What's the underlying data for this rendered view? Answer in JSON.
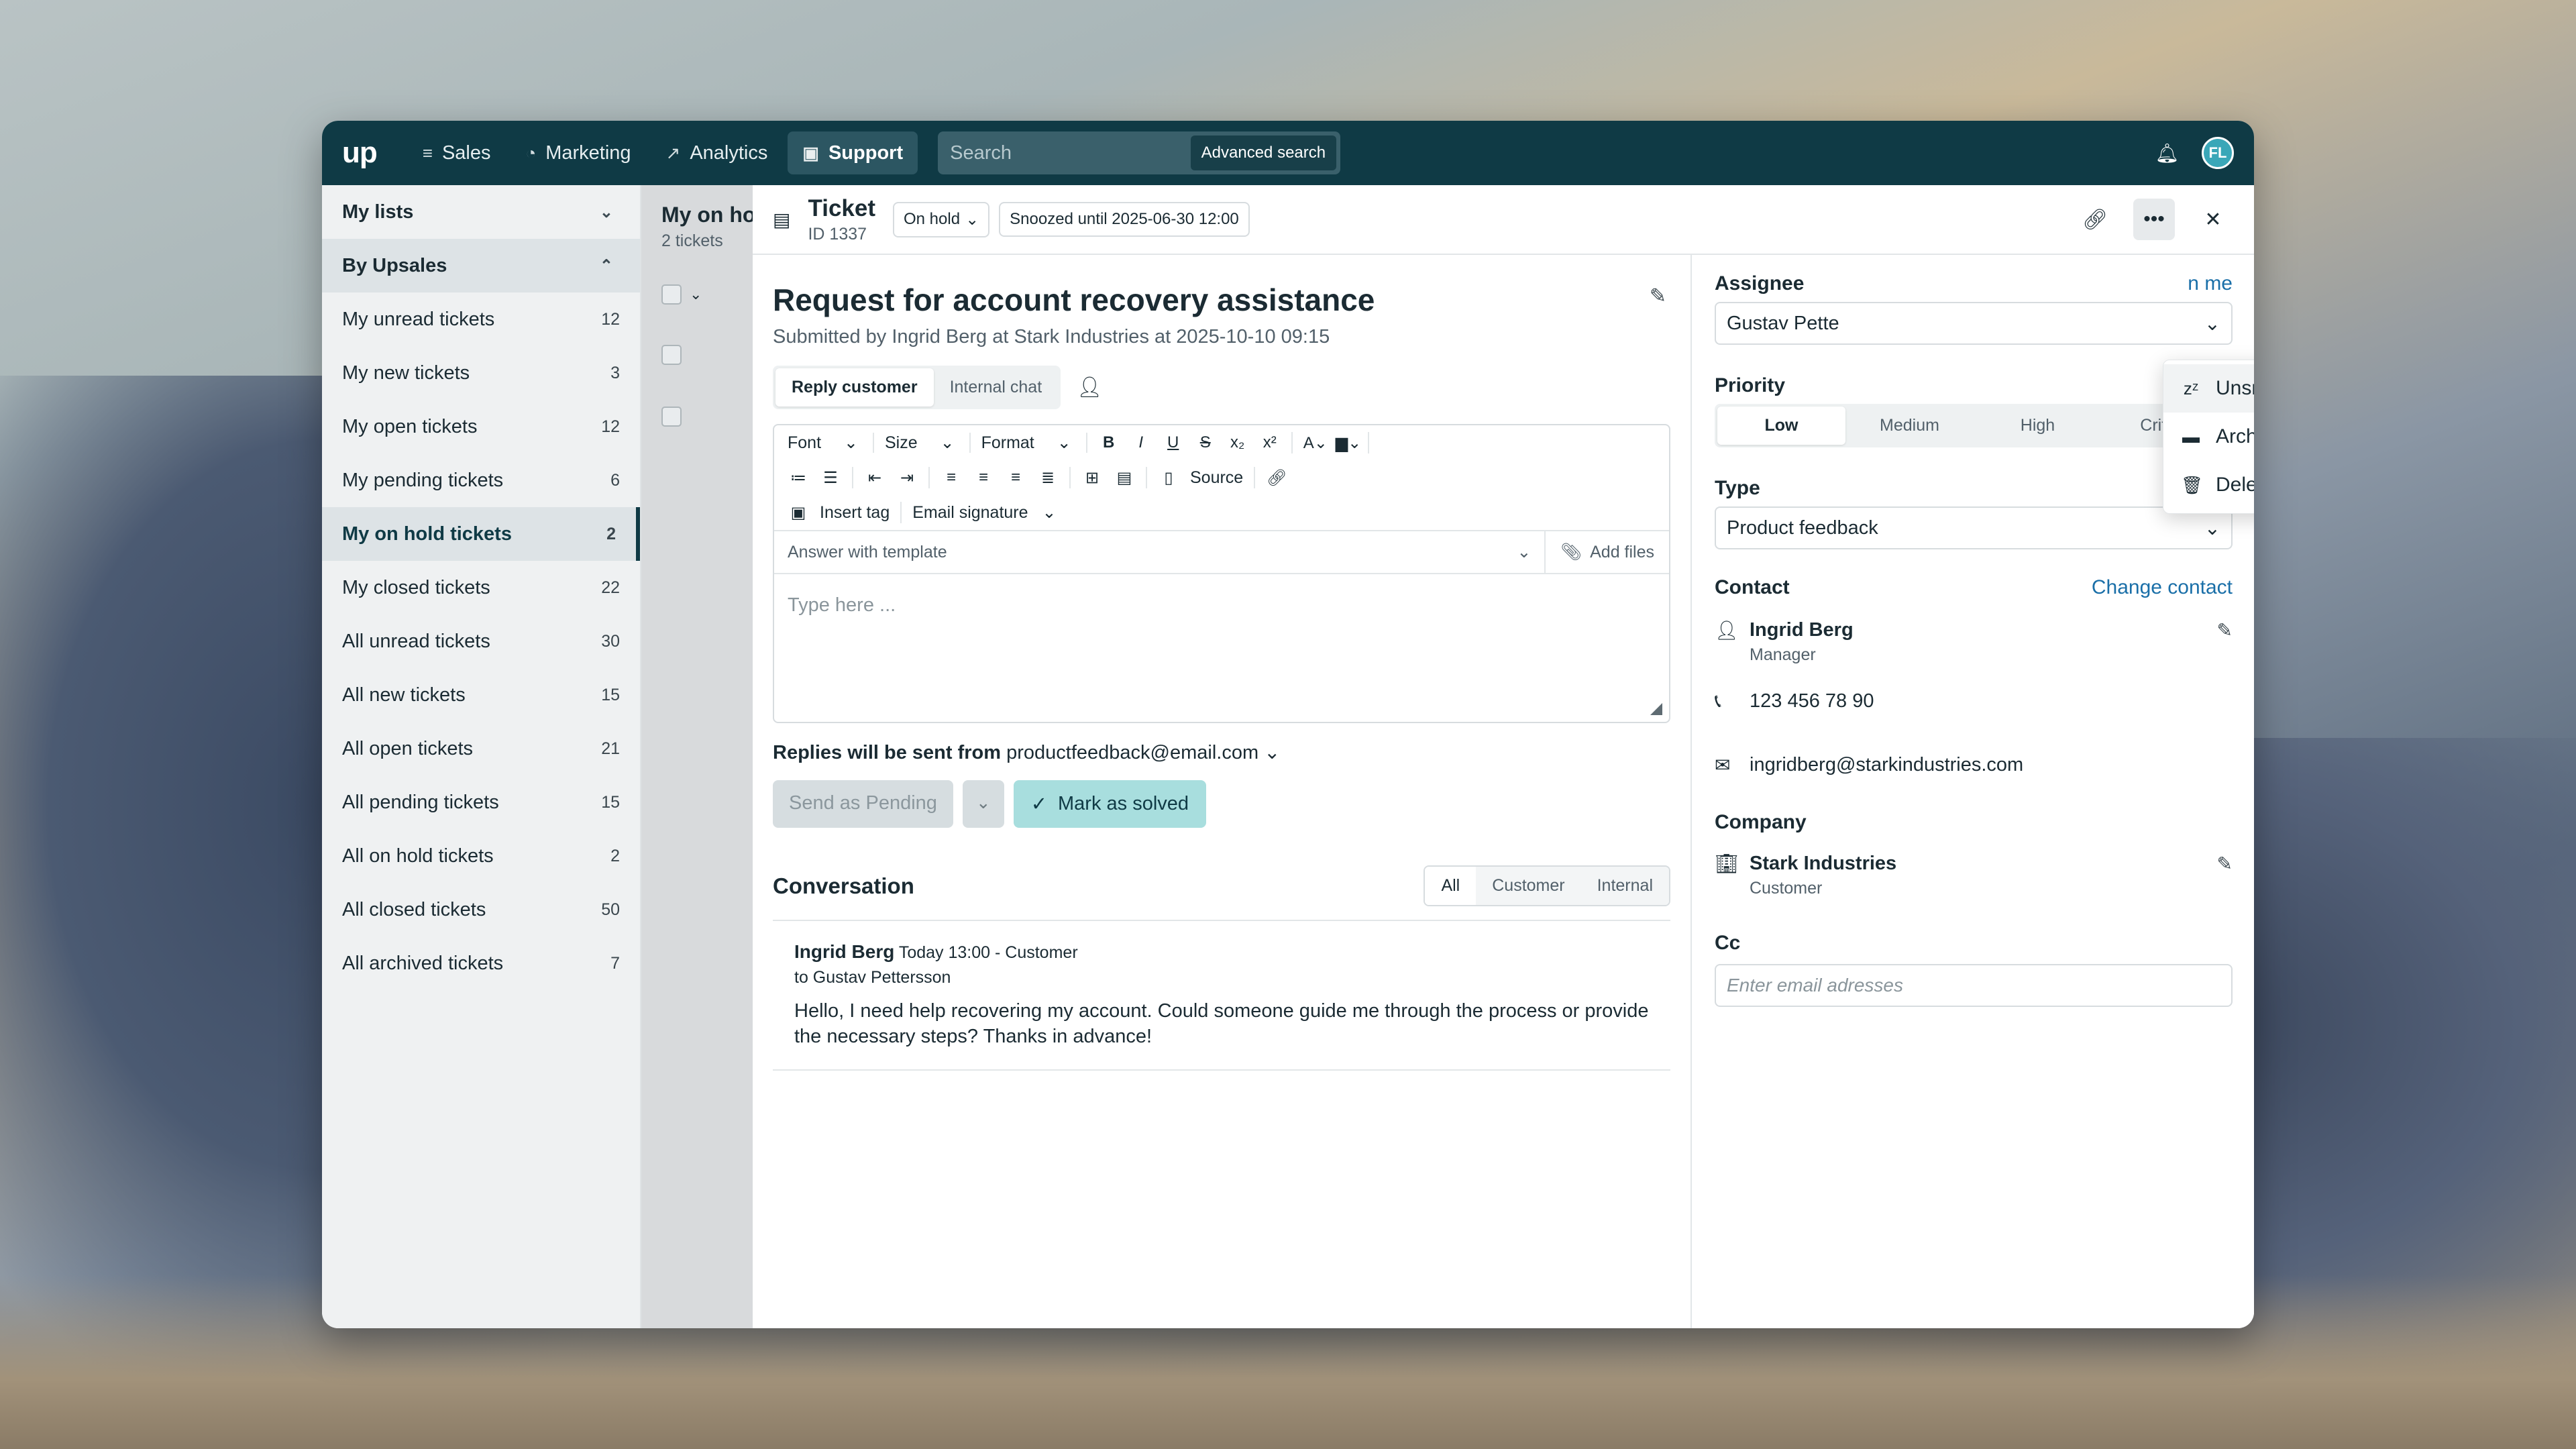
{
  "topbar": {
    "logo": "up",
    "nav": [
      {
        "label": "Sales",
        "icon": "filter-icon"
      },
      {
        "label": "Marketing",
        "icon": "marketing-icon"
      },
      {
        "label": "Analytics",
        "icon": "chart-icon"
      },
      {
        "label": "Support",
        "icon": "support-icon"
      }
    ],
    "search_placeholder": "Search",
    "advanced_search": "Advanced search",
    "avatar_initials": "FL"
  },
  "sidebar": {
    "my_lists": "My lists",
    "by_upsales": "By Upsales",
    "items": [
      {
        "label": "My unread tickets",
        "count": "12"
      },
      {
        "label": "My new tickets",
        "count": "3"
      },
      {
        "label": "My open tickets",
        "count": "12"
      },
      {
        "label": "My pending tickets",
        "count": "6"
      },
      {
        "label": "My on hold tickets",
        "count": "2"
      },
      {
        "label": "My closed tickets",
        "count": "22"
      },
      {
        "label": "All unread tickets",
        "count": "30"
      },
      {
        "label": "All new tickets",
        "count": "15"
      },
      {
        "label": "All open tickets",
        "count": "21"
      },
      {
        "label": "All pending tickets",
        "count": "15"
      },
      {
        "label": "All on hold tickets",
        "count": "2"
      },
      {
        "label": "All closed tickets",
        "count": "50"
      },
      {
        "label": "All archived tickets",
        "count": "7"
      }
    ],
    "active_index": 4
  },
  "list": {
    "title": "My on hold tickets",
    "count_label": "2 tickets"
  },
  "ticket": {
    "label": "Ticket",
    "id": "ID 1337",
    "status": "On hold",
    "snooze": "Snoozed until 2025-06-30 12:00",
    "title": "Request for account recovery assistance",
    "submitted": "Submitted by Ingrid Berg at Stark Industries at 2025-10-10 09:15"
  },
  "reply": {
    "tabs": [
      "Reply customer",
      "Internal chat"
    ],
    "font": "Font",
    "size": "Size",
    "format": "Format",
    "source": "Source",
    "insert_tag": "Insert tag",
    "email_signature": "Email signature",
    "template": "Answer with template",
    "add_files": "Add files",
    "placeholder": "Type here ...",
    "from_label": "Replies will be sent from",
    "from_email": "productfeedback@email.com",
    "send_btn": "Send as Pending",
    "solve_btn": "Mark as solved"
  },
  "conversation": {
    "title": "Conversation",
    "filters": [
      "All",
      "Customer",
      "Internal"
    ],
    "message": {
      "author": "Ingrid Berg",
      "meta": "Today 13:00 - Customer",
      "to": "to Gustav Pettersson",
      "body": "Hello, I need help recovering my account. Could someone guide me through the process or provide the necessary steps? Thanks in advance!"
    }
  },
  "details": {
    "assignee_label": "Assignee",
    "assignee_value": "Gustav Pette",
    "assign_me": "n me",
    "priority_label": "Priority",
    "priorities": [
      "Low",
      "Medium",
      "High",
      "Critical"
    ],
    "type_label": "Type",
    "type_value": "Product feedback",
    "contact_label": "Contact",
    "change_contact": "Change contact",
    "contact_name": "Ingrid Berg",
    "contact_title": "Manager",
    "phone": "123 456 78 90",
    "email": "ingridberg@starkindustries.com",
    "company_label": "Company",
    "company_name": "Stark Industries",
    "company_type": "Customer",
    "cc_label": "Cc",
    "cc_placeholder": "Enter email adresses"
  },
  "menu": {
    "items": [
      "Unsnooze",
      "Archive",
      "Delete"
    ]
  }
}
